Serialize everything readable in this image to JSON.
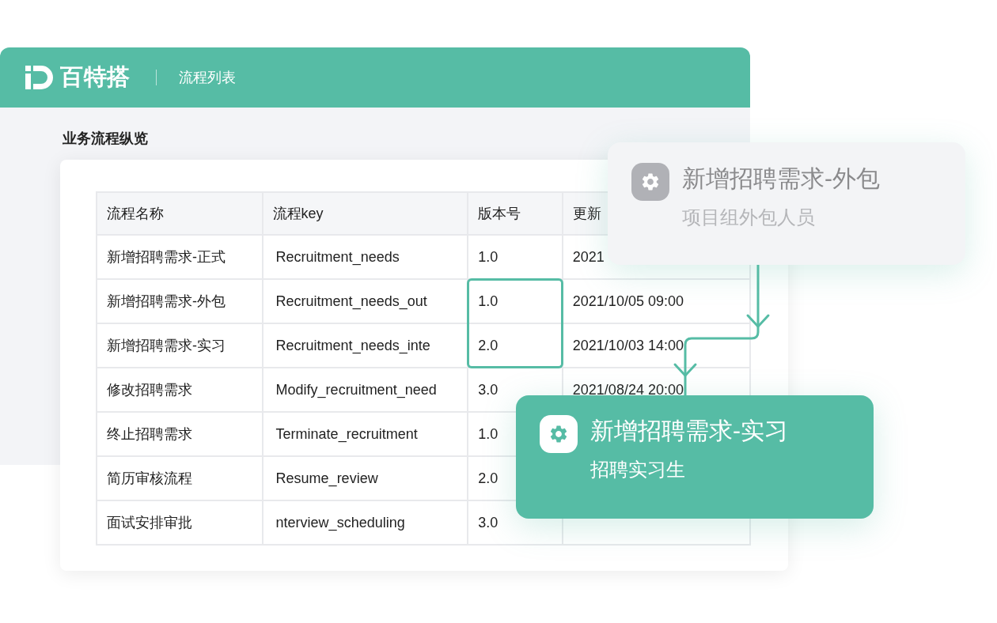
{
  "header": {
    "logo_text": "百特搭",
    "title": "流程列表"
  },
  "section_title": "业务流程纵览",
  "table": {
    "columns": [
      "流程名称",
      "流程key",
      "版本号",
      "更新"
    ],
    "rows": [
      {
        "name": "新增招聘需求-正式",
        "key": "Recruitment_needs",
        "version": "1.0",
        "updated": "2021",
        "highlighted": false
      },
      {
        "name": "新增招聘需求-外包",
        "key": "Recruitment_needs_out",
        "version": "1.0",
        "updated": "2021/10/05 09:00",
        "highlighted": true
      },
      {
        "name": "新增招聘需求-实习",
        "key": "Recruitment_needs_inte",
        "version": "2.0",
        "updated": "2021/10/03 14:00",
        "highlighted": true
      },
      {
        "name": "修改招聘需求",
        "key": "Modify_recruitment_need",
        "version": "3.0",
        "updated": "2021/08/24 20:00",
        "highlighted": false
      },
      {
        "name": "终止招聘需求",
        "key": "Terminate_recruitment",
        "version": "1.0",
        "highlighted": false
      },
      {
        "name": "简历审核流程",
        "key": "Resume_review",
        "version": "2.0",
        "highlighted": false
      },
      {
        "name": "面试安排审批",
        "key": "nterview_scheduling",
        "version": "3.0",
        "highlighted": false
      }
    ]
  },
  "cards": [
    {
      "kind": "muted",
      "title": "新增招聘需求-外包",
      "subtitle": "项目组外包人员"
    },
    {
      "kind": "accent",
      "title": "新增招聘需求-实习",
      "subtitle": "招聘实习生"
    }
  ]
}
